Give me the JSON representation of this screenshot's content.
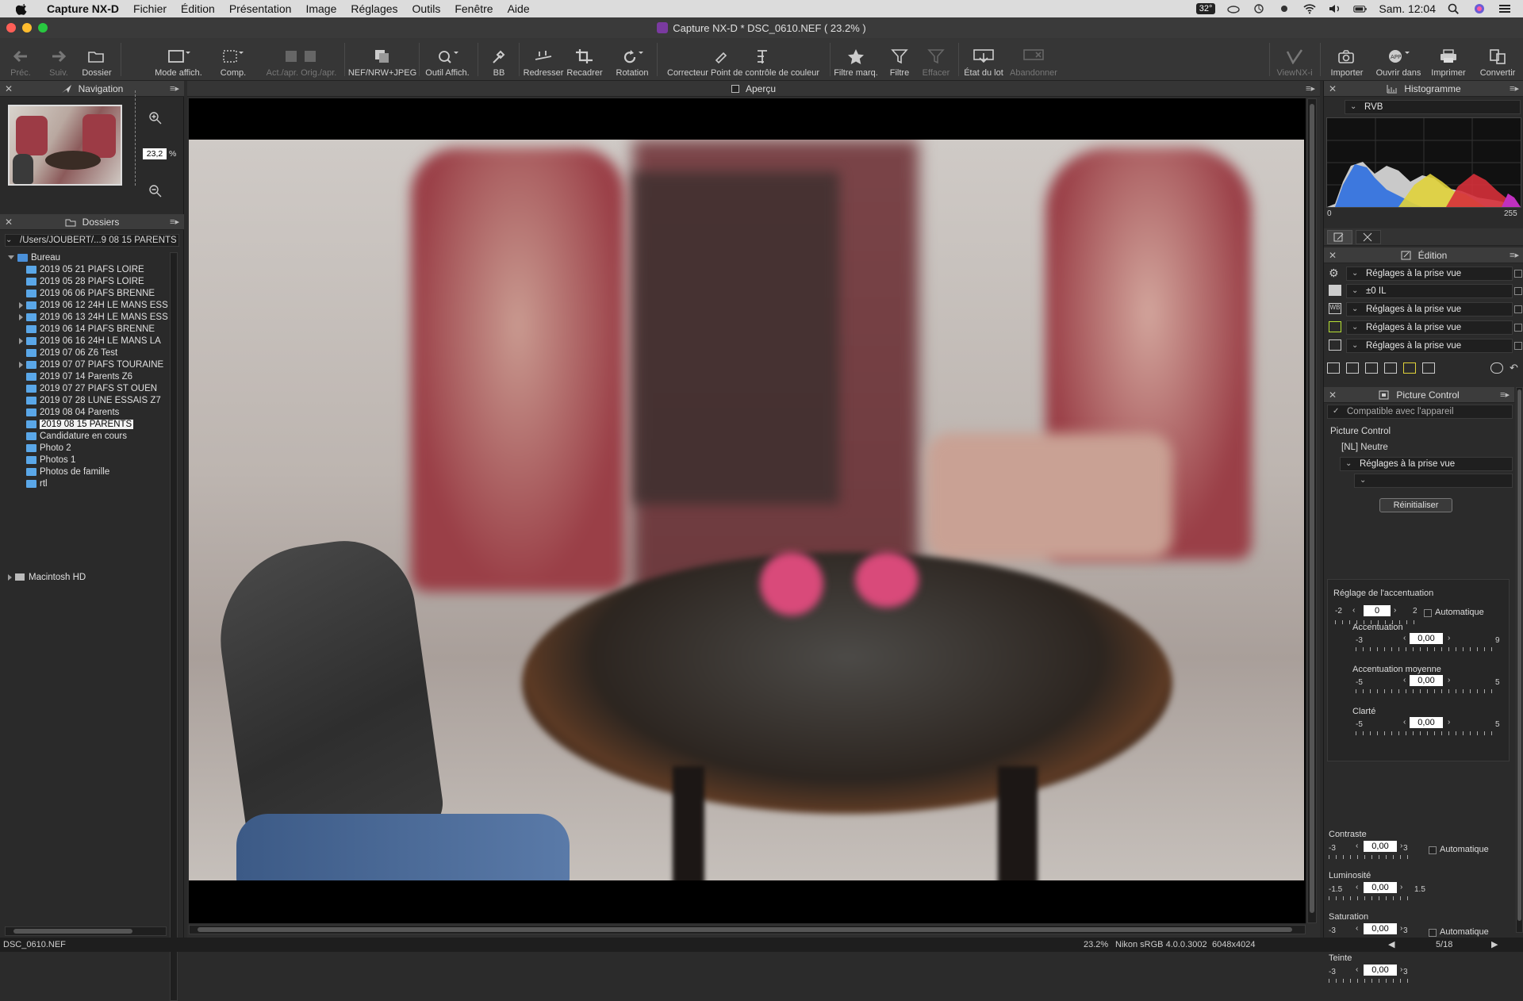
{
  "menubar": {
    "app": "Capture NX-D",
    "items": [
      "Fichier",
      "Édition",
      "Présentation",
      "Image",
      "Réglages",
      "Outils",
      "Fenêtre",
      "Aide"
    ],
    "temp": "32°",
    "clock": "Sam. 12:04"
  },
  "window": {
    "title": "Capture NX-D    * DSC_0610.NEF ( 23.2% )"
  },
  "toolbar": {
    "prev": "Préc.",
    "next": "Suiv.",
    "folder": "Dossier",
    "display_mode": "Mode affich.",
    "compare": "Comp.",
    "before_after": "Act./apr. Orig./apr.",
    "nef_jpeg": "NEF/NRW+JPEG",
    "view_tool": "Outil Affich.",
    "wb": "BB",
    "straighten": "Redresser",
    "crop": "Recadrer",
    "rotate": "Rotation",
    "control_point": "Correcteur Point de contrôle de couleur",
    "label_filter": "Filtre marq.",
    "filter": "Filtre",
    "clear": "Effacer",
    "batch_status": "État du lot",
    "abort": "Abandonner",
    "viewnx": "ViewNX-i",
    "import": "Importer",
    "open_in": "Ouvrir dans",
    "print": "Imprimer",
    "convert": "Convertir"
  },
  "navigation": {
    "title": "Navigation",
    "zoom": "23,2",
    "unit": "%"
  },
  "folders": {
    "title": "Dossiers",
    "path": "/Users/JOUBERT/...9 08 15 PARENTS",
    "root": "Bureau",
    "items": [
      {
        "label": "2019 05 21 PIAFS LOIRE",
        "expandable": false
      },
      {
        "label": "2019 05 28 PIAFS LOIRE",
        "expandable": false
      },
      {
        "label": "2019 06 06 PIAFS BRENNE",
        "expandable": false
      },
      {
        "label": "2019 06 12 24H LE MANS ESS",
        "expandable": true
      },
      {
        "label": "2019 06 13 24H LE MANS ESS",
        "expandable": true
      },
      {
        "label": "2019 06 14 PIAFS BRENNE",
        "expandable": false
      },
      {
        "label": "2019 06 16 24H LE MANS LA",
        "expandable": true
      },
      {
        "label": "2019 07 06 Z6 Test",
        "expandable": false
      },
      {
        "label": "2019 07 07 PIAFS TOURAINE",
        "expandable": true
      },
      {
        "label": "2019 07 14 Parents Z6",
        "expandable": false
      },
      {
        "label": "2019 07 27 PIAFS ST OUEN",
        "expandable": false
      },
      {
        "label": "2019 07 28 LUNE ESSAIS Z7",
        "expandable": false
      },
      {
        "label": "2019 08 04 Parents",
        "expandable": false
      },
      {
        "label": "2019 08 15 PARENTS",
        "expandable": false,
        "selected": true
      },
      {
        "label": "Candidature en cours",
        "expandable": false
      },
      {
        "label": "Photo 2",
        "expandable": false
      },
      {
        "label": "Photos 1",
        "expandable": false
      },
      {
        "label": "Photos de famille",
        "expandable": false
      },
      {
        "label": "rtl",
        "expandable": false
      }
    ],
    "drive": "Macintosh HD"
  },
  "center": {
    "title": "Aperçu"
  },
  "histogram": {
    "title": "Histogramme",
    "channel": "RVB",
    "min": "0",
    "max": "255"
  },
  "edit": {
    "title": "Édition",
    "rows": [
      "Réglages à la prise vue",
      "±0 IL",
      "Réglages à la prise vue",
      "Réglages à la prise vue",
      "Réglages à la prise vue"
    ]
  },
  "picture_control": {
    "title": "Picture Control",
    "compat": "Compatible avec l'appareil",
    "label": "Picture Control",
    "preset": "[NL] Neutre",
    "base": "Réglages à la prise vue",
    "reset": "Réinitialiser",
    "sharpen_title": "Réglage de l'accentuation",
    "sharpen": {
      "min": "-2",
      "max": "2",
      "value": "0",
      "auto": "Automatique"
    },
    "sliders": [
      {
        "label": "Accentuation",
        "min": "-3",
        "max": "9",
        "value": "0,00"
      },
      {
        "label": "Accentuation moyenne",
        "min": "-5",
        "max": "5",
        "value": "0,00"
      },
      {
        "label": "Clarté",
        "min": "-5",
        "max": "5",
        "value": "0,00"
      }
    ],
    "contrast": {
      "label": "Contraste",
      "min": "-3",
      "max": "3",
      "value": "0,00",
      "auto": "Automatique"
    },
    "brightness": {
      "label": "Luminosité",
      "min": "-1.5",
      "max": "1.5",
      "value": "0,00"
    },
    "saturation": {
      "label": "Saturation",
      "min": "-3",
      "max": "3",
      "value": "0,00",
      "auto": "Automatique"
    },
    "hue": {
      "label": "Teinte",
      "min": "-3",
      "max": "3",
      "value": "0,00"
    }
  },
  "status": {
    "file": "DSC_0610.NEF",
    "zoom": "23.2%",
    "profile": "Nikon sRGB 4.0.0.3002",
    "size": "6048x4024",
    "page": "5/18"
  }
}
